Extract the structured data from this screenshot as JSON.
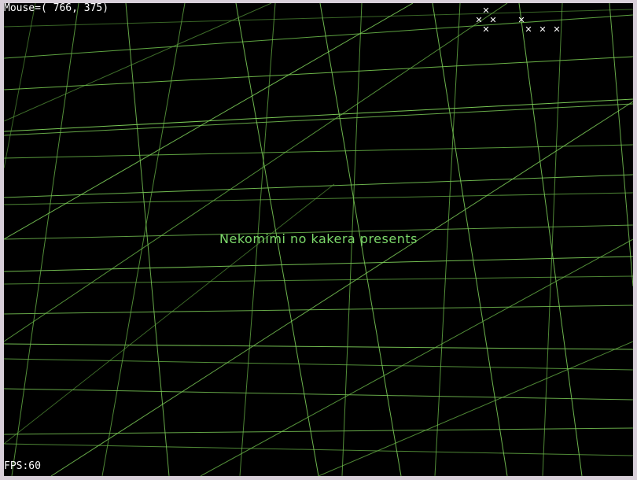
{
  "hud": {
    "mouse_readout": "Mouse=( 766, 375)",
    "fps_readout": "FPS:60"
  },
  "title": {
    "text": "Nekomimi no kakera presents"
  },
  "markers": {
    "icon": "x-marker-icon",
    "glyph": "✕",
    "count": 8,
    "color": "#ffffff"
  },
  "scene": {
    "background_color": "#000000",
    "grid_color": "#7fd25a",
    "window_frame_color": "#d8cfd9"
  }
}
